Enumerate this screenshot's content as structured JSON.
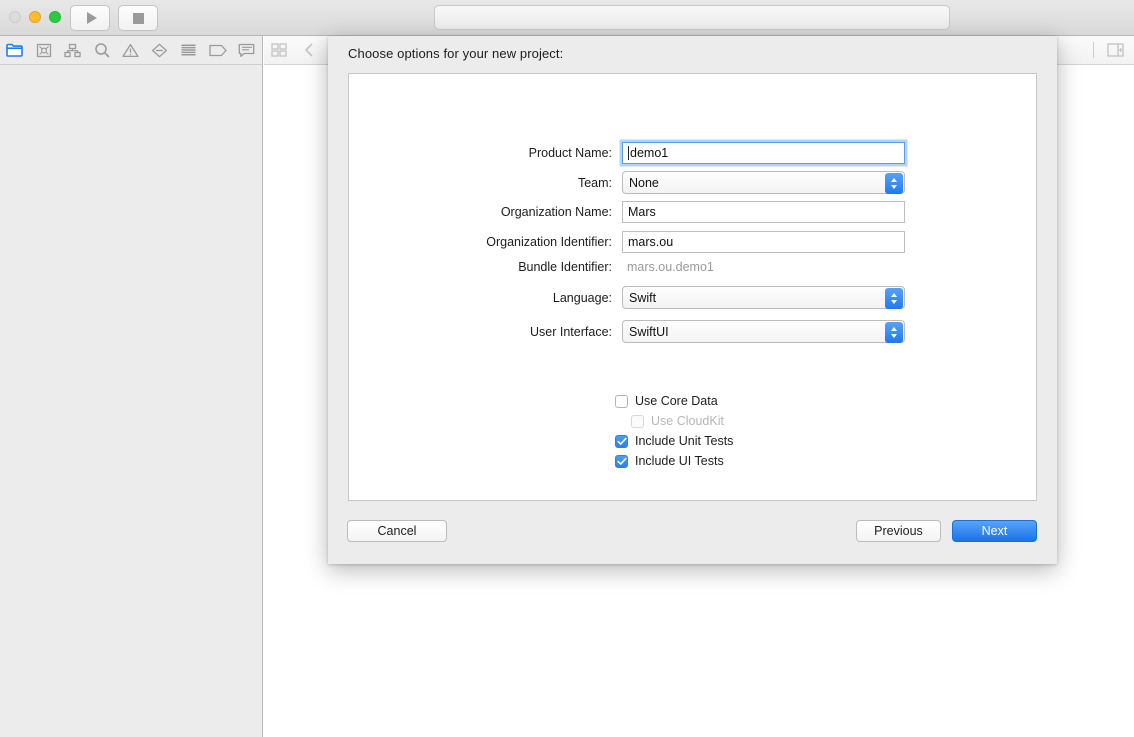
{
  "window": {
    "traffic_lights": [
      {
        "name": "close",
        "color": "#dcdcdc",
        "state": "disabled"
      },
      {
        "name": "minimize",
        "color": "#ffbd2e",
        "state": "enabled"
      },
      {
        "name": "zoom",
        "color": "#2acb42",
        "state": "enabled"
      }
    ],
    "run_button_icon": "play-icon",
    "stop_button_icon": "stop-icon",
    "activity_bar_text": ""
  },
  "navigator": {
    "icons": [
      {
        "name": "project-navigator-icon",
        "selected": true
      },
      {
        "name": "source-control-navigator-icon",
        "selected": false
      },
      {
        "name": "symbol-navigator-icon",
        "selected": false
      },
      {
        "name": "find-navigator-icon",
        "selected": false
      },
      {
        "name": "issue-navigator-icon",
        "selected": false
      },
      {
        "name": "test-navigator-icon",
        "selected": false
      },
      {
        "name": "debug-navigator-icon",
        "selected": false
      },
      {
        "name": "breakpoint-navigator-icon",
        "selected": false
      },
      {
        "name": "report-navigator-icon",
        "selected": false
      }
    ]
  },
  "editor_toolbar": {
    "left_icons": [
      {
        "name": "editor-layout-icon"
      },
      {
        "name": "back-chevron-icon"
      },
      {
        "name": "forward-chevron-icon"
      }
    ],
    "right_icons": [
      {
        "name": "inspector-toggle-icon"
      }
    ]
  },
  "dialog": {
    "title": "Choose options for your new project:",
    "fields": [
      {
        "name": "product-name",
        "label": "Product Name:",
        "value": "demo1",
        "type": "text",
        "focused": true
      },
      {
        "name": "team",
        "label": "Team:",
        "value": "None",
        "type": "popup",
        "focused": false
      },
      {
        "name": "organization-name",
        "label": "Organization Name:",
        "value": "Mars",
        "type": "text",
        "focused": false
      },
      {
        "name": "organization-identifier",
        "label": "Organization Identifier:",
        "value": "mars.ou",
        "type": "text",
        "focused": false
      },
      {
        "name": "bundle-identifier",
        "label": "Bundle Identifier:",
        "value": "mars.ou.demo1",
        "type": "static",
        "focused": false
      },
      {
        "name": "language",
        "label": "Language:",
        "value": "Swift",
        "type": "popup",
        "focused": false
      },
      {
        "name": "user-interface",
        "label": "User Interface:",
        "value": "SwiftUI",
        "type": "popup",
        "focused": false
      }
    ],
    "checkboxes": [
      {
        "name": "use-core-data",
        "label": "Use Core Data",
        "checked": false,
        "disabled": false,
        "indent": 0
      },
      {
        "name": "use-cloudkit",
        "label": "Use CloudKit",
        "checked": false,
        "disabled": true,
        "indent": 1
      },
      {
        "name": "include-unit-tests",
        "label": "Include Unit Tests",
        "checked": true,
        "disabled": false,
        "indent": 0
      },
      {
        "name": "include-ui-tests",
        "label": "Include UI Tests",
        "checked": true,
        "disabled": false,
        "indent": 0
      }
    ],
    "buttons": {
      "cancel": "Cancel",
      "previous": "Previous",
      "next": "Next"
    }
  },
  "colors": {
    "accent_blue": "#1a73e8",
    "focus_ring": "#5a9bea",
    "sheet_background": "#ececec",
    "sidebar_background": "#ececec"
  }
}
